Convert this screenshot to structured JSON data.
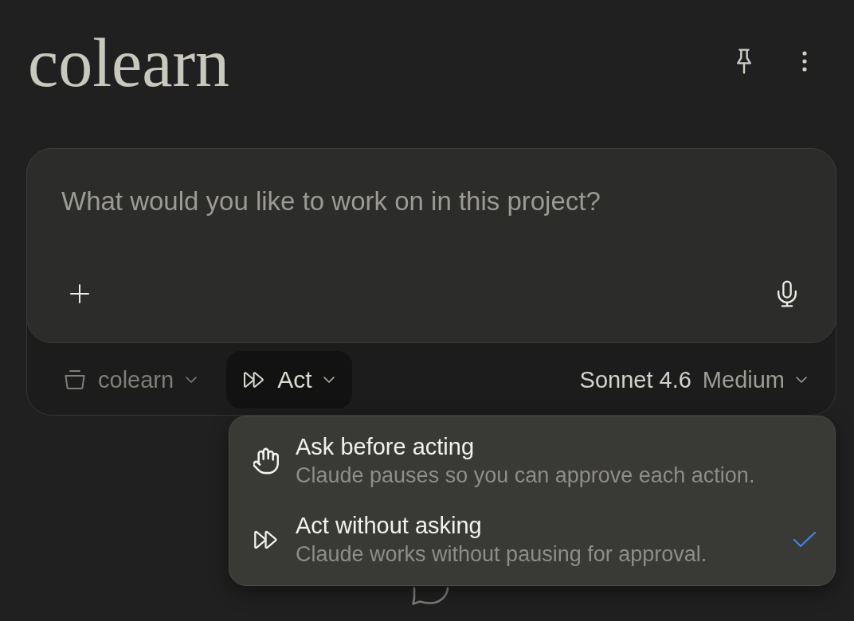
{
  "header": {
    "title": "colearn"
  },
  "composer": {
    "placeholder": "What would you like to work on in this project?",
    "project_selector": {
      "label": "colearn"
    },
    "mode_button": {
      "label": "Act",
      "expanded": true
    },
    "model_selector": {
      "model": "Sonnet 4.6",
      "effort": "Medium"
    }
  },
  "mode_menu": {
    "items": [
      {
        "kind": "ask",
        "title": "Ask before acting",
        "description": "Claude pauses so you can approve each action.",
        "selected": false
      },
      {
        "kind": "act",
        "title": "Act without asking",
        "description": "Claude works without pausing for approval.",
        "selected": true
      }
    ]
  }
}
